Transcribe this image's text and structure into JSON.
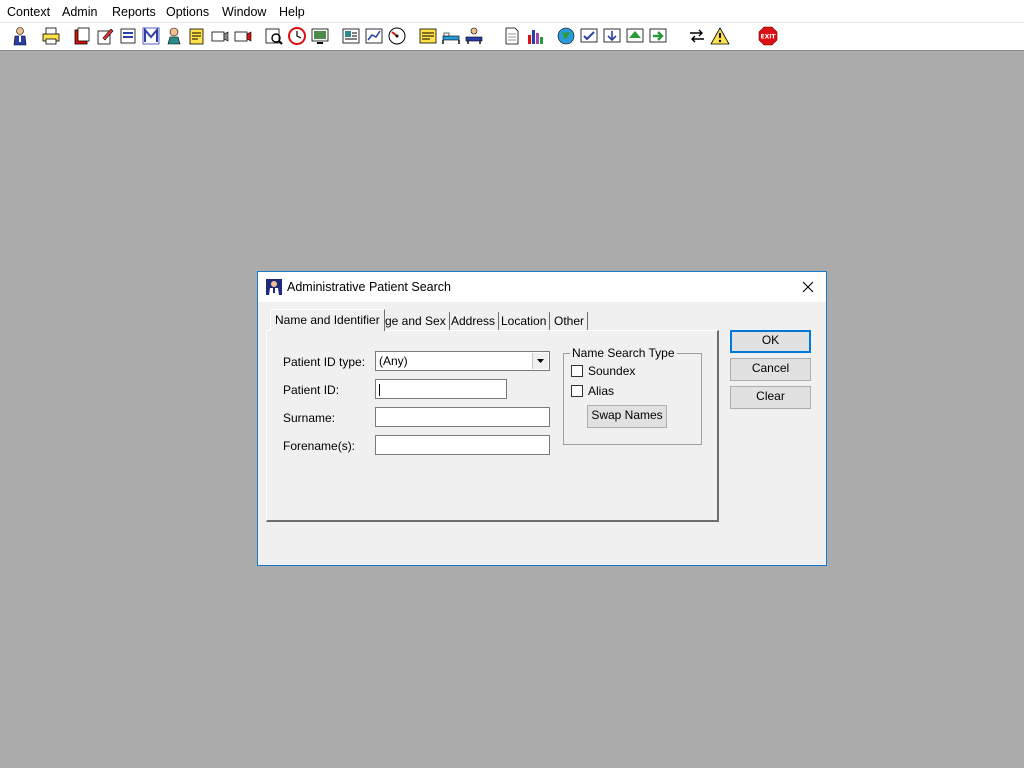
{
  "menubar": {
    "items": [
      "Context",
      "Admin",
      "Reports",
      "Options",
      "Window",
      "Help"
    ]
  },
  "toolbar": {
    "icons": [
      "person-icon",
      "printer-icon",
      "book-icon",
      "edit-icon",
      "search-doc-icon",
      "m-icon",
      "doctor-icon",
      "notes-icon",
      "camera-icon",
      "camera2-icon",
      "magnify-icon",
      "clock-icon",
      "monitor-icon",
      "report-icon",
      "chart-icon",
      "gauge-icon",
      "note-icon",
      "bed-icon",
      "transfer-icon",
      "document-icon",
      "bar-chart-icon",
      "globe-icon",
      "check-icon",
      "down-arrow-icon",
      "green-arrow-icon",
      "green-arrow2-icon",
      "swap-icon",
      "warning-icon",
      "exit-icon"
    ]
  },
  "dialog": {
    "title": "Administrative Patient Search",
    "tabs": [
      "Name and Identifier",
      "Age and Sex",
      "Address",
      "Location",
      "Other"
    ],
    "labels": {
      "patient_id_type": "Patient ID type:",
      "patient_id": "Patient ID:",
      "surname": "Surname:",
      "forenames": "Forename(s):"
    },
    "patient_id_type_value": "(Any)",
    "patient_id_value": "",
    "surname_value": "",
    "forenames_value": "",
    "group_title": "Name Search Type",
    "soundex_label": "Soundex",
    "alias_label": "Alias",
    "soundex_checked": false,
    "alias_checked": false,
    "swap_names": "Swap Names",
    "buttons": {
      "ok": "OK",
      "cancel": "Cancel",
      "clear": "Clear"
    }
  },
  "colors": {
    "desktop": "#ababab",
    "dialog_bg": "#f0f0f0",
    "accent": "#0078d7"
  }
}
